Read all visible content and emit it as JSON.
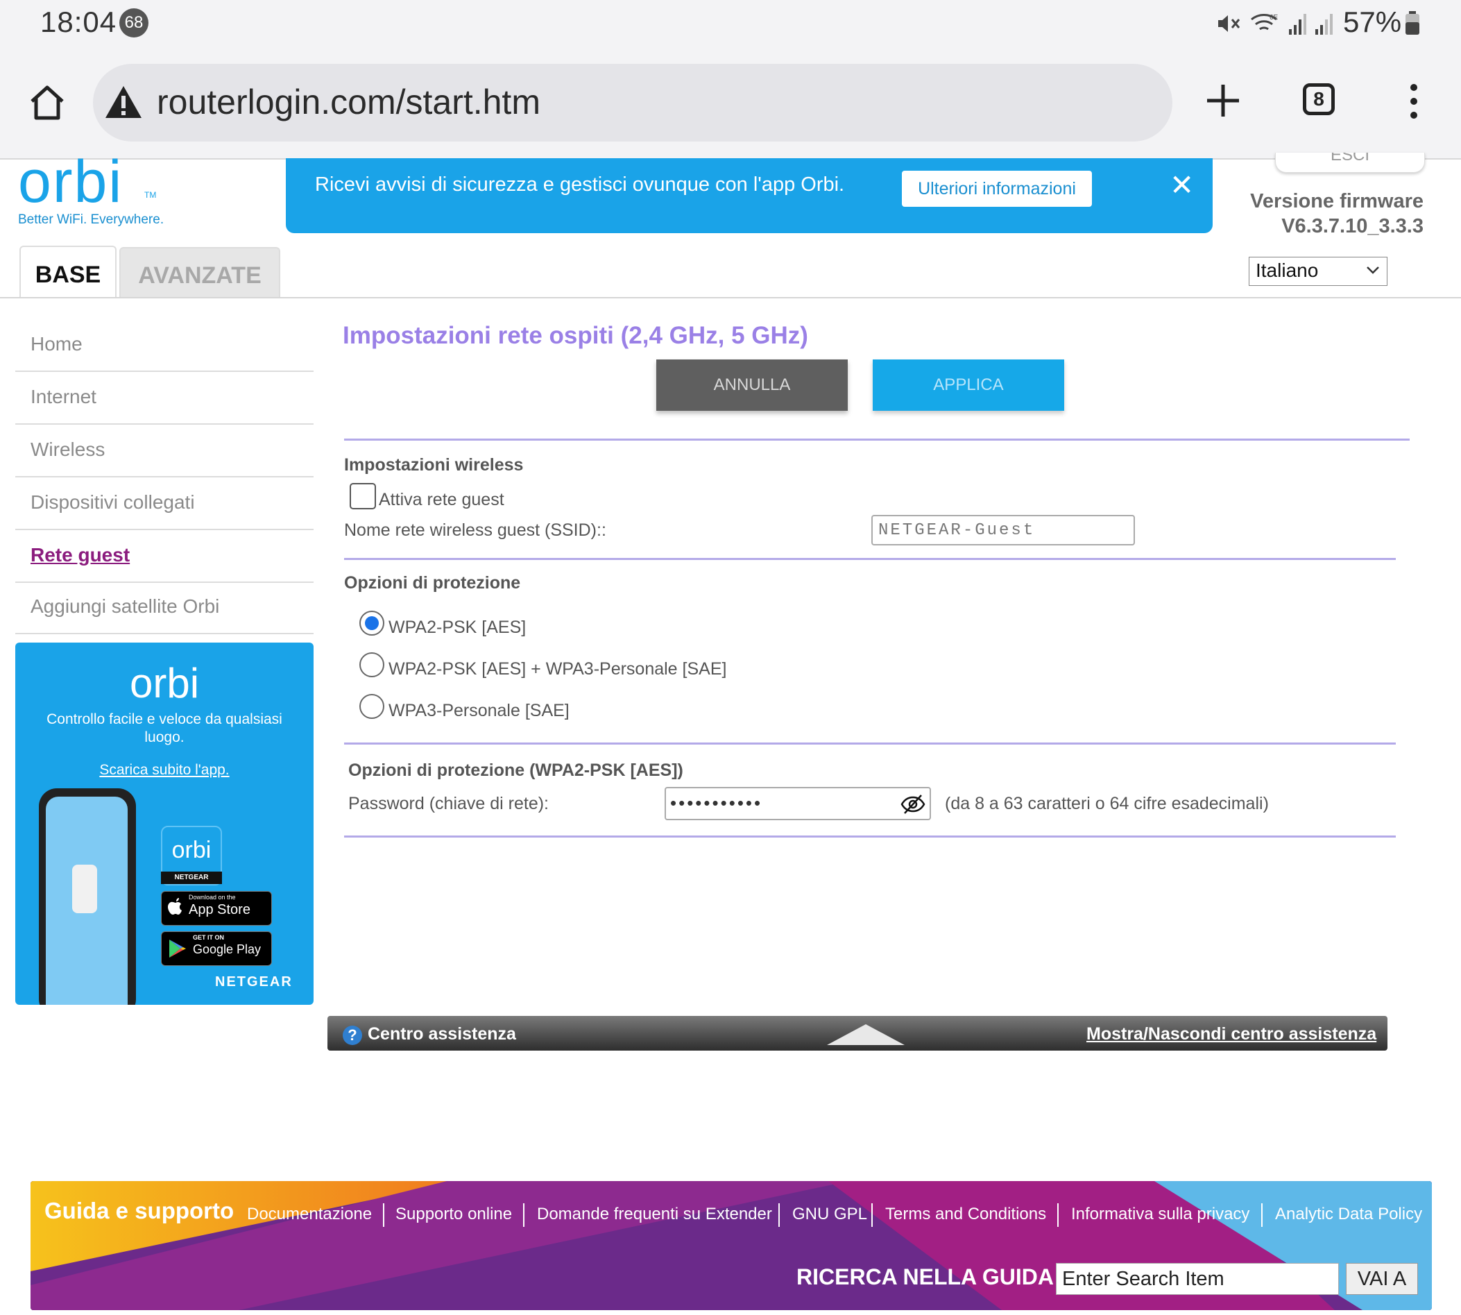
{
  "status_bar": {
    "time": "18:04",
    "notification_count": "68",
    "battery": "57%",
    "icons": [
      "mute-icon",
      "wifi-6e-icon",
      "signal-icon",
      "signal-icon",
      "battery-icon"
    ]
  },
  "browser": {
    "url": "routerlogin.com/start.htm",
    "tab_count": "8",
    "icons": [
      "home-icon",
      "warning-icon",
      "plus-icon",
      "tabs-icon",
      "more-vert-icon"
    ]
  },
  "header": {
    "logo": "orbi",
    "tagline": "Better WiFi. Everywhere.",
    "banner_text": "Ricevi avvisi di sicurezza e gestisci ovunque con l'app Orbi.",
    "banner_button": "Ulteriori informazioni",
    "logout_label": "ESCI",
    "firmware_label": "Versione firmware",
    "firmware_version": "V6.3.7.10_3.3.3",
    "language": "Italiano"
  },
  "tabs": [
    {
      "label": "BASE",
      "active": true
    },
    {
      "label": "AVANZATE",
      "active": false
    }
  ],
  "sidebar": {
    "items": [
      {
        "label": "Home"
      },
      {
        "label": "Internet"
      },
      {
        "label": "Wireless"
      },
      {
        "label": "Dispositivi collegati"
      },
      {
        "label": "Rete guest",
        "active": true
      },
      {
        "label": "Aggiungi satellite Orbi"
      }
    ],
    "promo": {
      "logo": "orbi",
      "text": "Controllo facile e veloce da qualsiasi luogo.",
      "link": "Scarica subito l'app.",
      "app_tile_brand": "NETGEAR",
      "appstore_small": "Download on the",
      "appstore_big": "App Store",
      "googleplay_small": "GET IT ON",
      "googleplay_big": "Google Play",
      "brand": "NETGEAR"
    }
  },
  "main": {
    "title": "Impostazioni rete ospiti (2,4 GHz, 5 GHz)",
    "cancel_button": "ANNULLA",
    "apply_button": "APPLICA",
    "wireless_heading": "Impostazioni wireless",
    "enable_guest_label": "Attiva rete guest",
    "enable_guest_checked": false,
    "ssid_label": "Nome rete wireless guest (SSID)::",
    "ssid_value": "NETGEAR-Guest",
    "protection_heading": "Opzioni di protezione",
    "protection_options": [
      {
        "label": "WPA2-PSK [AES]",
        "selected": true
      },
      {
        "label": "WPA2-PSK [AES] + WPA3-Personale [SAE]",
        "selected": false
      },
      {
        "label": "WPA3-Personale [SAE]",
        "selected": false
      }
    ],
    "protection_detail_heading": "Opzioni di protezione (WPA2-PSK [AES])",
    "password_label": "Password (chiave di rete):",
    "password_masked": "•••••••••••",
    "password_hint": "(da 8 a 63 caratteri o 64 cifre esadecimali)"
  },
  "help_center": {
    "label": "Centro assistenza",
    "toggle": "Mostra/Nascondi centro assistenza"
  },
  "footer": {
    "title": "Guida e supporto",
    "links": [
      "Documentazione",
      "Supporto online",
      "Domande frequenti su Extender",
      "GNU GPL",
      "Terms and Conditions",
      "Informativa sulla privacy",
      "Analytic Data Policy"
    ],
    "search_label": "RICERCA NELLA GUIDA",
    "search_value": "Enter Search Item",
    "search_button": "VAI A"
  },
  "colors": {
    "brand_blue": "#1aa3e8",
    "title_purple": "#9a80e6",
    "active_nav": "#8b1c7e",
    "footer_purple": "#6b2a8a"
  }
}
